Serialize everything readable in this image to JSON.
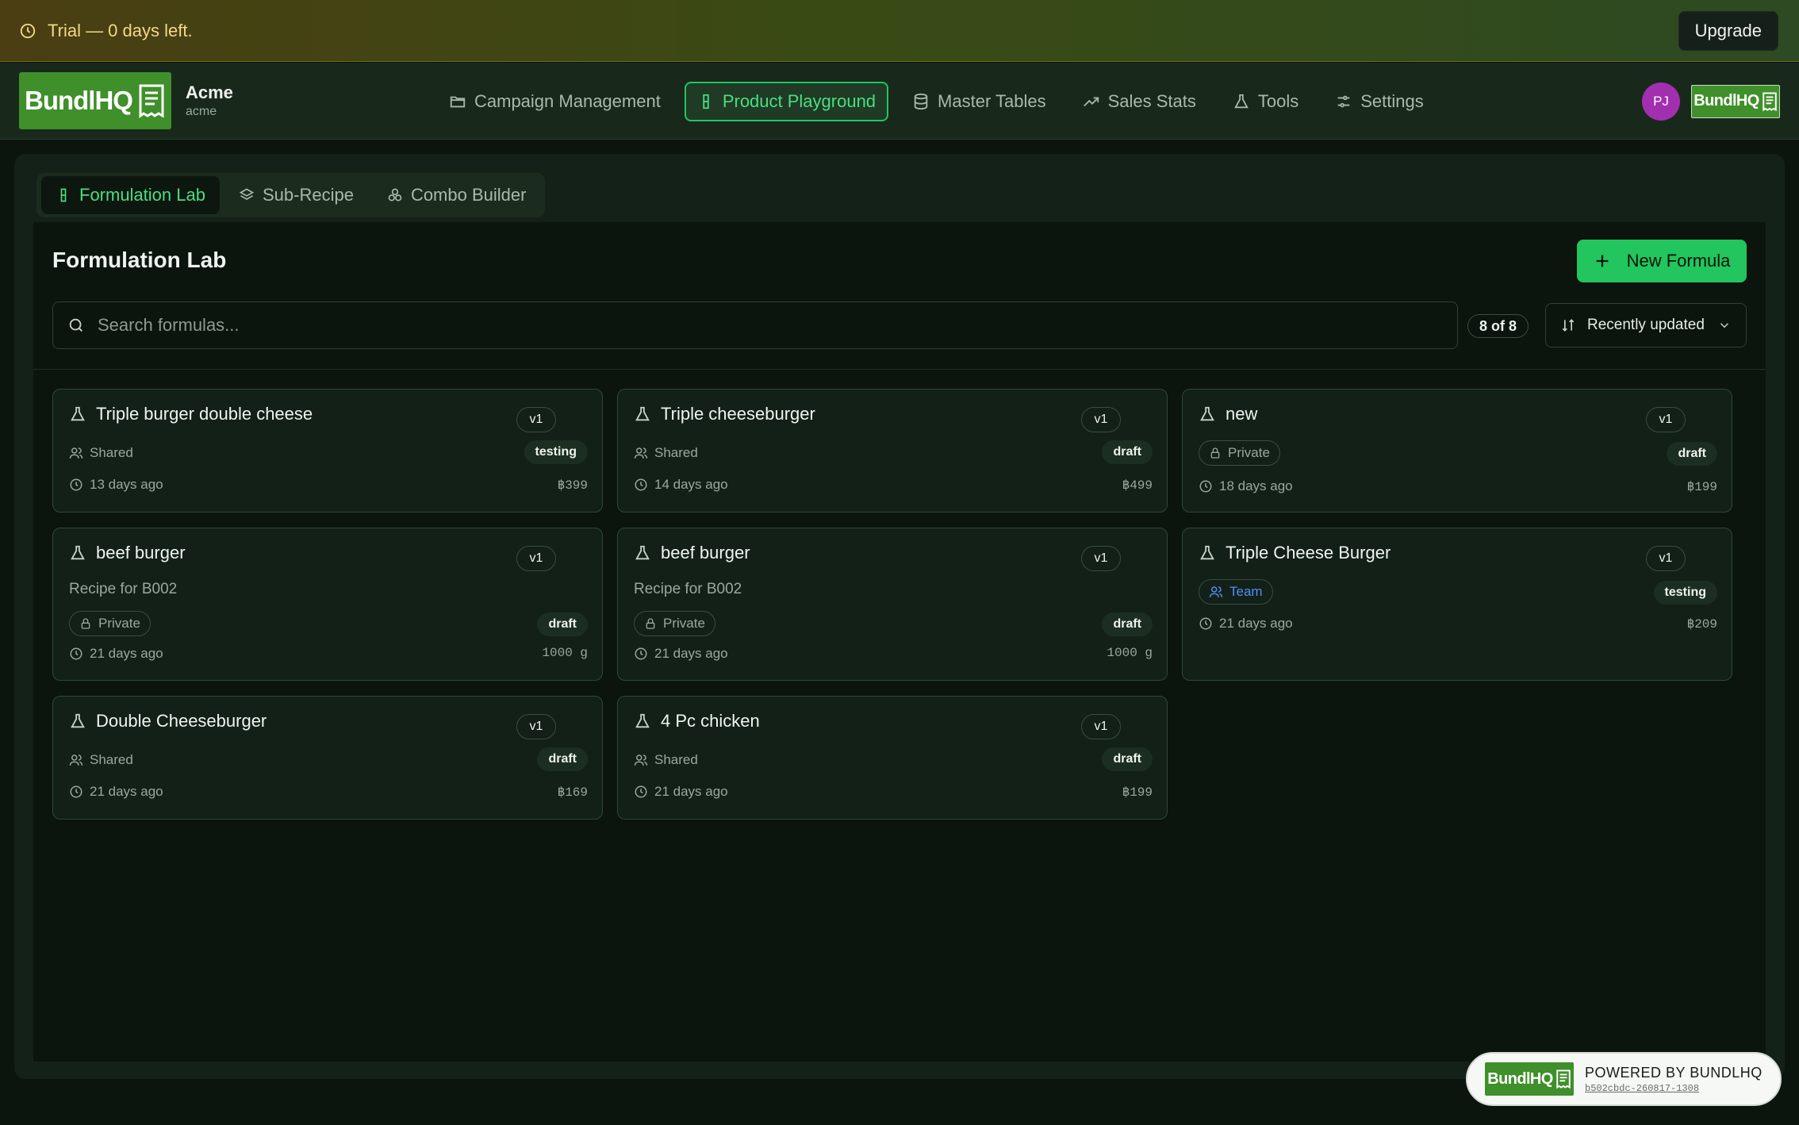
{
  "banner": {
    "text": "Trial — 0 days left.",
    "upgrade_label": "Upgrade"
  },
  "brand": {
    "logo_text": "BundlHQ",
    "org_name": "Acme",
    "org_slug": "acme"
  },
  "nav": [
    {
      "label": "Campaign Management",
      "icon": "folder-icon",
      "active": false
    },
    {
      "label": "Product Playground",
      "icon": "flask-icon",
      "active": true
    },
    {
      "label": "Master Tables",
      "icon": "database-icon",
      "active": false
    },
    {
      "label": "Sales Stats",
      "icon": "trending-up-icon",
      "active": false
    },
    {
      "label": "Tools",
      "icon": "beaker-icon",
      "active": false
    },
    {
      "label": "Settings",
      "icon": "sliders-icon",
      "active": false
    }
  ],
  "user": {
    "initials": "PJ"
  },
  "subtabs": [
    {
      "label": "Formulation Lab",
      "active": true
    },
    {
      "label": "Sub-Recipe",
      "active": false
    },
    {
      "label": "Combo Builder",
      "active": false
    }
  ],
  "page": {
    "title": "Formulation Lab",
    "new_button": "New Formula",
    "search_placeholder": "Search formulas...",
    "count": "8 of 8",
    "sort": "Recently updated"
  },
  "formulas": [
    {
      "title": "Triple burger double cheese",
      "version": "v1",
      "visibility": "Shared",
      "status": "testing",
      "updated": "13 days ago",
      "value": "฿399"
    },
    {
      "title": "Triple cheeseburger",
      "version": "v1",
      "visibility": "Shared",
      "status": "draft",
      "updated": "14 days ago",
      "value": "฿499"
    },
    {
      "title": "new",
      "version": "v1",
      "visibility": "Private",
      "status": "draft",
      "updated": "18 days ago",
      "value": "฿199"
    },
    {
      "title": "beef burger",
      "version": "v1",
      "description": "Recipe for B002",
      "visibility": "Private",
      "status": "draft",
      "updated": "21 days ago",
      "value": "1000 g"
    },
    {
      "title": "beef burger",
      "version": "v1",
      "description": "Recipe for B002",
      "visibility": "Private",
      "status": "draft",
      "updated": "21 days ago",
      "value": "1000 g"
    },
    {
      "title": "Triple Cheese Burger",
      "version": "v1",
      "visibility": "Team",
      "status": "testing",
      "updated": "21 days ago",
      "value": "฿209"
    },
    {
      "title": "Double Cheeseburger",
      "version": "v1",
      "visibility": "Shared",
      "status": "draft",
      "updated": "21 days ago",
      "value": "฿169"
    },
    {
      "title": "4 Pc chicken",
      "version": "v1",
      "visibility": "Shared",
      "status": "draft",
      "updated": "21 days ago",
      "value": "฿199"
    }
  ],
  "powered": {
    "text": "POWERED BY BUNDLHQ",
    "hash": "b502cbdc-260817-1308"
  },
  "colors": {
    "accent": "#22c55e",
    "accent_text": "#4ade80",
    "team": "#4f8ef7",
    "avatar": "#a22fb0"
  }
}
